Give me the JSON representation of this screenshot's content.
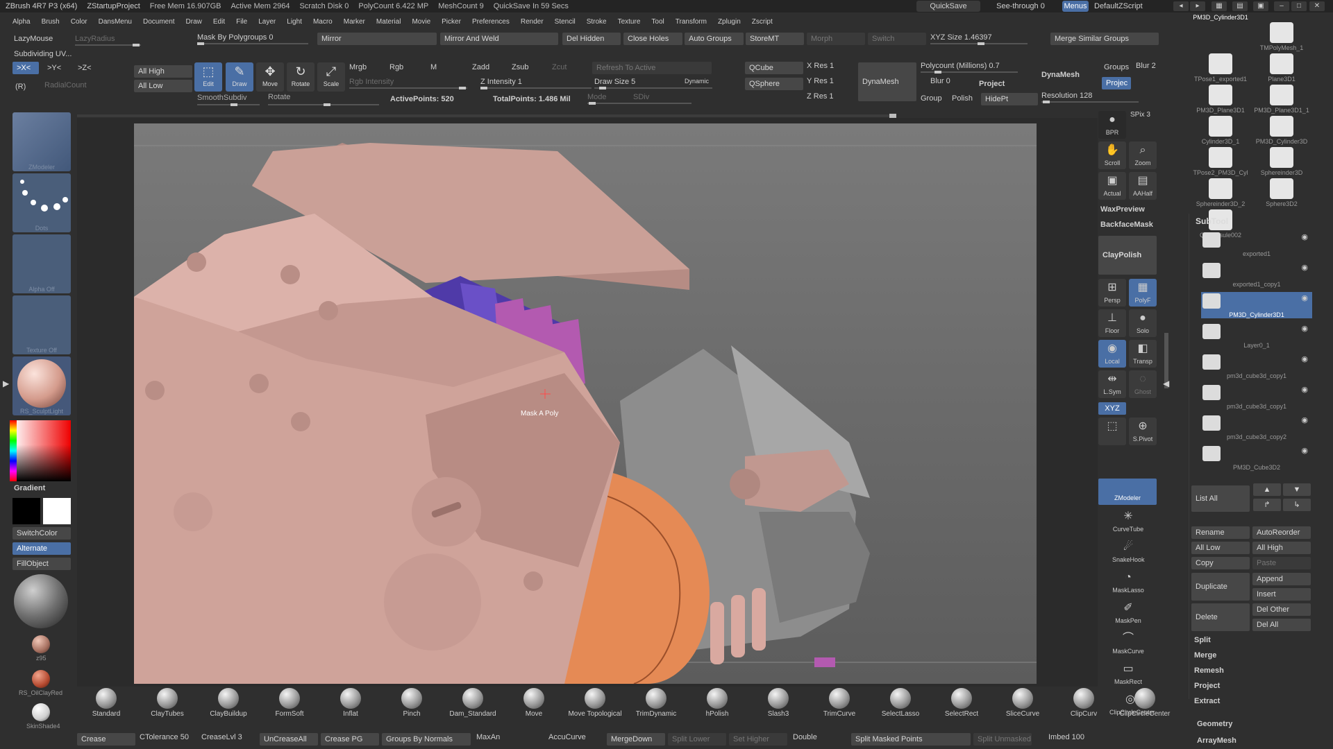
{
  "title_bar": {
    "app": "ZBrush 4R7 P3 (x64)",
    "project": "ZStartupProject",
    "free_mem": "Free Mem 16.907GB",
    "active_mem": "Active Mem 2964",
    "scratch": "Scratch Disk 0",
    "polycount": "PolyCount 6.422 MP",
    "meshcount": "MeshCount 9",
    "quicksave_in": "QuickSave In 59 Secs",
    "quicksave": "QuickSave",
    "see_through": "See-through",
    "see_through_val": "0",
    "menus": "Menus",
    "script": "DefaultZScript"
  },
  "menu": [
    "Alpha",
    "Brush",
    "Color",
    "DansMenu",
    "Document",
    "Draw",
    "Edit",
    "File",
    "Layer",
    "Light",
    "Macro",
    "Marker",
    "Material",
    "Movie",
    "Picker",
    "Preferences",
    "Render",
    "Stencil",
    "Stroke",
    "Texture",
    "Tool",
    "Transform",
    "Zplugin",
    "Zscript"
  ],
  "toolbar": {
    "lazymouse": "LazyMouse",
    "lazyradius": "LazyRadius",
    "subdividing": "Subdividing UV...",
    "mask_by_polygroups": "Mask By Polygroups 0",
    "mirror": "Mirror",
    "mirror_weld": "Mirror And Weld",
    "del_hidden": "Del Hidden",
    "close_holes": "Close Holes",
    "auto_groups": "Auto Groups",
    "storemt": "StoreMT",
    "morph": "Morph",
    "switch": "Switch",
    "xyz_size": "XYZ Size 1.46397",
    "merge_similar": "Merge Similar Groups",
    "sym_x": ">X<",
    "sym_y": ">Y<",
    "sym_z": ">Z<",
    "sym_r": "(R)",
    "radial_count": "RadialCount",
    "all_high": "All High",
    "all_low": "All Low",
    "smooth_subdiv": "SmoothSubdiv",
    "rotate": "Rotate",
    "edit": "Edit",
    "draw": "Draw",
    "move": "Move",
    "rotate_btn": "Rotate",
    "scale": "Scale",
    "mrgb": "Mrgb",
    "rgb": "Rgb",
    "m": "M",
    "rgb_intensity": "Rgb Intensity",
    "zadd": "Zadd",
    "zsub": "Zsub",
    "zcut": "Zcut",
    "z_intensity": "Z Intensity 1",
    "active_points": "ActivePoints: 520",
    "total_points": "TotalPoints: 1.486 Mil",
    "refresh": "Refresh To Active",
    "draw_size": "Draw Size 5",
    "dynamic": "Dynamic",
    "mode": "Mode",
    "sdiv": "SDiv",
    "qcube": "QCube",
    "qsphere": "QSphere",
    "x_res": "X Res 1",
    "y_res": "Y Res 1",
    "z_res": "Z Res 1",
    "dynamesh": "DynaMesh",
    "polycount_m": "Polycount (Millions) 0.7",
    "blur": "Blur 0",
    "project": "Project",
    "group": "Group",
    "polish": "Polish",
    "hidept": "HidePt",
    "dynamesh_lbl": "DynaMesh",
    "groups": "Groups",
    "blur2": "Blur 2",
    "projec": "Projec",
    "resolution": "Resolution 128",
    "edit_icon": "edit-icon",
    "draw_icon": "draw-icon",
    "move_icon": "move-icon",
    "rotate_icon": "rotate-icon",
    "scale_icon": "scale-icon"
  },
  "left_panel": {
    "zmodeler": "ZModeler",
    "dots": "Dots",
    "alpha_off": "Alpha Off",
    "texture_off": "Texture Off",
    "material": "RS_SculptLight",
    "gradient": "Gradient",
    "switchcolor": "SwitchColor",
    "alternate": "Alternate",
    "fillobject": "FillObject",
    "z95": "z95",
    "oilclay": "RS_OilClayRed",
    "skinshade": "SkinShade4",
    "main_color": "#e8e8e8",
    "secondary_color": "#000000"
  },
  "viewport": {
    "cursor_label": "Mask A Poly",
    "bg_color": "#6f6f6f",
    "mesh_color": "#cfa39a",
    "mask_color": "#4f3aa8",
    "ring_color": "#e58a55"
  },
  "right_tools": {
    "spix": "SPix 3",
    "bpr": "BPR",
    "scroll": "Scroll",
    "zoom": "Zoom",
    "actual": "Actual",
    "aahalf": "AAHalf",
    "waxpreview": "WaxPreview",
    "backfacemask": "BackfaceMask",
    "claypolish": "ClayPolish",
    "persp": "Persp",
    "polyf": "PolyF",
    "floor": "Floor",
    "solo": "Solo",
    "local": "Local",
    "transp": "Transp",
    "lsym": "L.Sym",
    "ghost": "Ghost",
    "xyz": "XYZ",
    "spivot": "S.Pivot",
    "zmodeler": "ZModeler",
    "curvetube": "CurveTube",
    "snakehook": "SnakeHook",
    "masklasso": "MaskLasso",
    "maskpen": "MaskPen",
    "maskcurve": "MaskCurve",
    "maskrect": "MaskRect",
    "clipcirclecenter": "ClipCircleCenter",
    "bpr_icon": "bpr-render-icon",
    "scroll_icon": "hand-icon",
    "zoom_icon": "magnifier-icon",
    "actual_icon": "actual-size-icon",
    "aahalf_icon": "aa-half-icon",
    "persp_icon": "perspective-icon",
    "polyf_icon": "polyframe-icon",
    "floor_icon": "floor-grid-icon",
    "solo_icon": "solo-icon",
    "local_icon": "local-icon",
    "transp_icon": "transparency-icon",
    "lsym_icon": "local-symmetry-icon",
    "ghost_icon": "ghost-icon",
    "spivot_icon": "pivot-icon",
    "curvetube_icon": "curvetube-brush-icon",
    "snakehook_icon": "snakehook-brush-icon",
    "masklasso_icon": "masklasso-icon",
    "maskpen_icon": "maskpen-icon",
    "maskcurve_icon": "maskcurve-icon",
    "maskrect_icon": "maskrect-icon",
    "clipcircle_icon": "clipcircle-icon"
  },
  "brushes": [
    "Standard",
    "ClayTubes",
    "ClayBuildup",
    "FormSoft",
    "Inflat",
    "Pinch",
    "Dam_Standard",
    "Move",
    "Move Topological",
    "TrimDynamic",
    "hPolish",
    "Slash3",
    "TrimCurve",
    "SelectLasso",
    "SelectRect",
    "SliceCurve",
    "ClipCurv",
    "ClipCircleCenter"
  ],
  "bottom_bar": {
    "crease": "Crease",
    "ctolerance": "CTolerance 50",
    "creaselvl": "CreaseLvl 3",
    "uncreaseall": "UnCreaseAll",
    "crease_pg": "Crease PG",
    "groups_by_normals": "Groups By Normals",
    "maxangle": "MaxAn",
    "accucurve": "AccuCurve",
    "mergedown": "MergeDown",
    "gui_lower": "Split Lower",
    "set_higher": "Set Higher",
    "double": "Double",
    "split_masked": "Split Masked Points",
    "split_unmasked": "Split Unmasked",
    "imbed": "Imbed 100"
  },
  "projects": [
    {
      "label": "PM3D_Cylinder3D1"
    },
    {
      "label": "TMPolyMesh_1"
    },
    {
      "label": "TPose1_exported1"
    },
    {
      "label": "Plane3D1"
    },
    {
      "label": "PM3D_Plane3D1"
    },
    {
      "label": "PM3D_Plane3D1_1"
    },
    {
      "label": "Cylinder3D_1"
    },
    {
      "label": "PM3D_Cylinder3D"
    },
    {
      "label": "TPose2_PM3D_Cyl"
    },
    {
      "label": "Sphereinder3D"
    },
    {
      "label": "Sphereinder3D_2"
    },
    {
      "label": "Sphere3D2"
    },
    {
      "label": "Q_Capsule002"
    }
  ],
  "subtool": {
    "header": "SubTool",
    "items": [
      {
        "label": "exported1"
      },
      {
        "label": "exported1_copy1"
      },
      {
        "label": "PM3D_Cylinder3D1"
      },
      {
        "label": "Layer0_1"
      },
      {
        "label": "pm3d_cube3d_copy1"
      },
      {
        "label": "pm3d_cube3d_copy1"
      },
      {
        "label": "pm3d_cube3d_copy2"
      },
      {
        "label": "PM3D_Cube3D2"
      }
    ],
    "list_all": "List All",
    "rename": "Rename",
    "autoreorder": "AutoReorder",
    "all_low": "All Low",
    "all_high": "All High",
    "copy": "Copy",
    "paste": "Paste",
    "duplicate": "Duplicate",
    "append": "Append",
    "insert": "Insert",
    "delete": "Delete",
    "del_other": "Del Other",
    "del_all": "Del All",
    "split": "Split",
    "merge": "Merge",
    "remesh": "Remesh",
    "project": "Project",
    "extract": "Extract",
    "geometry": "Geometry",
    "arraymesh": "ArrayMesh"
  },
  "icons": {
    "eye": "eye-icon",
    "up": "arrow-up-icon",
    "down": "arrow-down-icon"
  }
}
